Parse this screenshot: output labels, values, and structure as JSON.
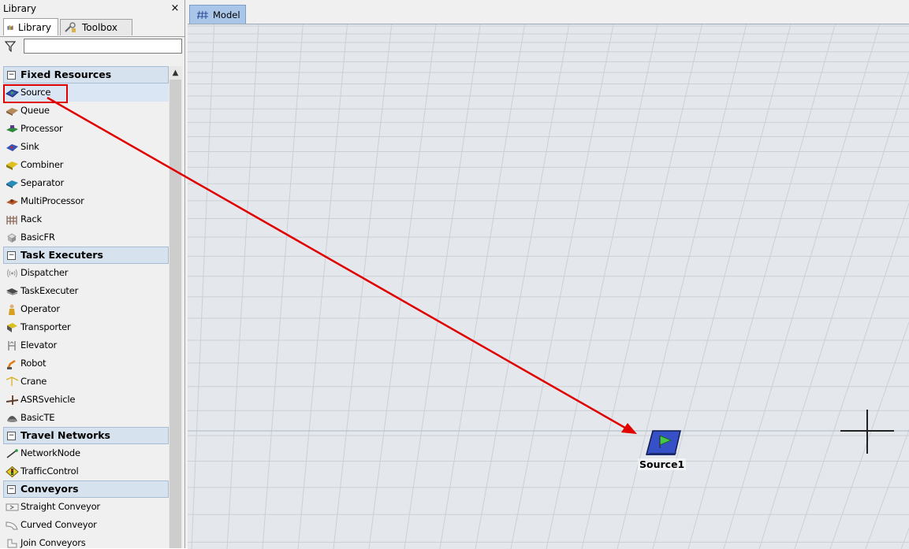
{
  "library_panel": {
    "title": "Library",
    "close_glyph": "×",
    "tabs": [
      {
        "label": "Library",
        "icon": "library-icon",
        "active": true
      },
      {
        "label": "Toolbox",
        "icon": "toolbox-icon",
        "active": false
      }
    ],
    "filter": {
      "value": "",
      "placeholder": "",
      "icon": "filter-icon"
    },
    "categories": [
      {
        "label": "Fixed Resources",
        "items": [
          {
            "label": "Source",
            "icon": "source-icon",
            "selected": true
          },
          {
            "label": "Queue",
            "icon": "queue-icon"
          },
          {
            "label": "Processor",
            "icon": "processor-icon"
          },
          {
            "label": "Sink",
            "icon": "sink-icon"
          },
          {
            "label": "Combiner",
            "icon": "combiner-icon"
          },
          {
            "label": "Separator",
            "icon": "separator-icon"
          },
          {
            "label": "MultiProcessor",
            "icon": "multiprocessor-icon"
          },
          {
            "label": "Rack",
            "icon": "rack-icon"
          },
          {
            "label": "BasicFR",
            "icon": "basicfr-icon"
          }
        ]
      },
      {
        "label": "Task Executers",
        "items": [
          {
            "label": "Dispatcher",
            "icon": "dispatcher-icon"
          },
          {
            "label": "TaskExecuter",
            "icon": "taskexecuter-icon"
          },
          {
            "label": "Operator",
            "icon": "operator-icon"
          },
          {
            "label": "Transporter",
            "icon": "transporter-icon"
          },
          {
            "label": "Elevator",
            "icon": "elevator-icon"
          },
          {
            "label": "Robot",
            "icon": "robot-icon"
          },
          {
            "label": "Crane",
            "icon": "crane-icon"
          },
          {
            "label": "ASRSvehicle",
            "icon": "asrsvehicle-icon"
          },
          {
            "label": "BasicTE",
            "icon": "basicte-icon"
          }
        ]
      },
      {
        "label": "Travel Networks",
        "items": [
          {
            "label": "NetworkNode",
            "icon": "networknode-icon"
          },
          {
            "label": "TrafficControl",
            "icon": "trafficcontrol-icon"
          }
        ]
      },
      {
        "label": "Conveyors",
        "items": [
          {
            "label": "Straight Conveyor",
            "icon": "straight-conveyor-icon"
          },
          {
            "label": "Curved Conveyor",
            "icon": "curved-conveyor-icon"
          },
          {
            "label": "Join Conveyors",
            "icon": "join-conveyors-icon"
          }
        ]
      }
    ]
  },
  "model": {
    "tab_label": "Model",
    "tab_icon": "model-grid-icon",
    "objects": [
      {
        "label": "Source1",
        "icon": "source-icon"
      }
    ]
  },
  "annotation": {
    "color": "#e00000"
  }
}
